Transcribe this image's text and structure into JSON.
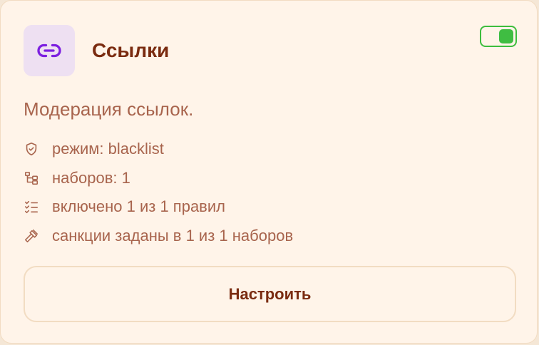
{
  "module": {
    "icon": "link-icon",
    "title": "Ссылки",
    "enabled": true,
    "description": "Модерация ссылок.",
    "info": [
      {
        "icon": "shield-icon",
        "text": "режим: blacklist"
      },
      {
        "icon": "tree-icon",
        "text": "наборов: 1"
      },
      {
        "icon": "checklist-icon",
        "text": "включено 1 из 1 правил"
      },
      {
        "icon": "gavel-icon",
        "text": "санкции заданы в 1 из 1 наборов"
      }
    ],
    "action_label": "Настроить"
  },
  "colors": {
    "accent": "#7a2b10",
    "text": "#a8644d",
    "toggle_on": "#3fbd42",
    "icon_purple": "#7c1fe0",
    "icon_tile": "#eee0f2"
  }
}
